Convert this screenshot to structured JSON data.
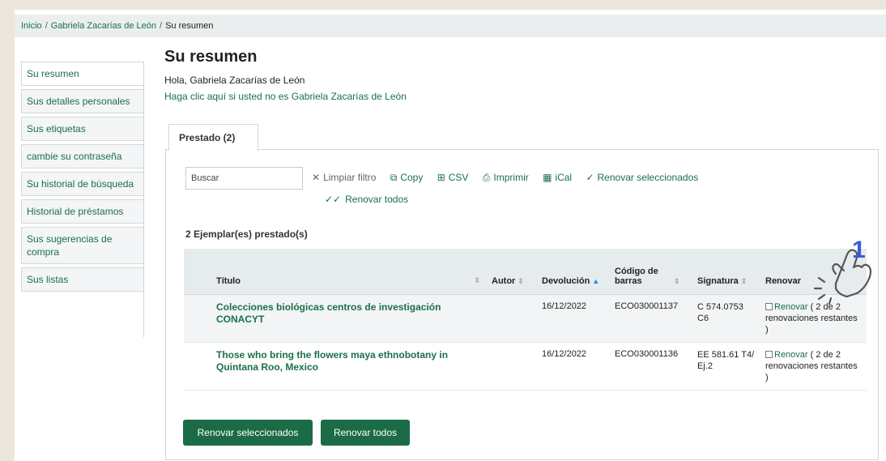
{
  "breadcrumb": {
    "home": "Inicio",
    "user": "Gabriela Zacarías de León",
    "current": "Su resumen",
    "separator": "/"
  },
  "sidebar": {
    "items": [
      {
        "label": "Su resumen"
      },
      {
        "label": "Sus detalles personales"
      },
      {
        "label": "Sus etiquetas"
      },
      {
        "label": "cambie su contraseña"
      },
      {
        "label": "Su historial de búsqueda"
      },
      {
        "label": "Historial de préstamos"
      },
      {
        "label": "Sus sugerencias de compra"
      },
      {
        "label": "Sus listas"
      }
    ]
  },
  "main": {
    "title": "Su resumen",
    "greeting": "Hola, Gabriela Zacarías de León",
    "not_me": "Haga clic aquí si usted no es Gabriela Zacarías de León",
    "tab_label": "Prestado (2)"
  },
  "toolbar": {
    "search_placeholder": "Buscar",
    "clear_filter": "Limpiar filtro",
    "copy": "Copy",
    "csv": "CSV",
    "print": "Imprimir",
    "ical": "iCal",
    "renew_selected": "Renovar seleccionados",
    "renew_all": "Renovar todos"
  },
  "checkouts": {
    "count_label": "2 Ejemplar(es) prestado(s)",
    "columns": {
      "title": "Título",
      "author": "Autor",
      "due": "Devolución",
      "barcode": "Código de barras",
      "callnumber": "Signatura",
      "renew": "Renovar"
    },
    "rows": [
      {
        "title": "Colecciones biológicas centros de investigación CONACYT",
        "author": "",
        "due": "16/12/2022",
        "barcode": "ECO030001137",
        "callnumber": "C 574.0753 C6",
        "renew_label": "Renovar",
        "renew_info": "( 2 de 2 renovaciones restantes )"
      },
      {
        "title": "Those who bring the flowers maya ethnobotany in Quintana Roo, Mexico",
        "author": "",
        "due": "16/12/2022",
        "barcode": "ECO030001136",
        "callnumber": "EE 581.61 T4/ Ej.2",
        "renew_label": "Renovar",
        "renew_info": "( 2 de 2 renovaciones restantes )"
      }
    ]
  },
  "buttons": {
    "renew_selected": "Renovar seleccionados",
    "renew_all": "Renovar todos"
  },
  "annotation": {
    "step_number": "1",
    "accent_color": "#3a5bd9"
  },
  "colors": {
    "link": "#1b6f4a",
    "button": "#1c6b47",
    "background": "#ede6dc"
  }
}
